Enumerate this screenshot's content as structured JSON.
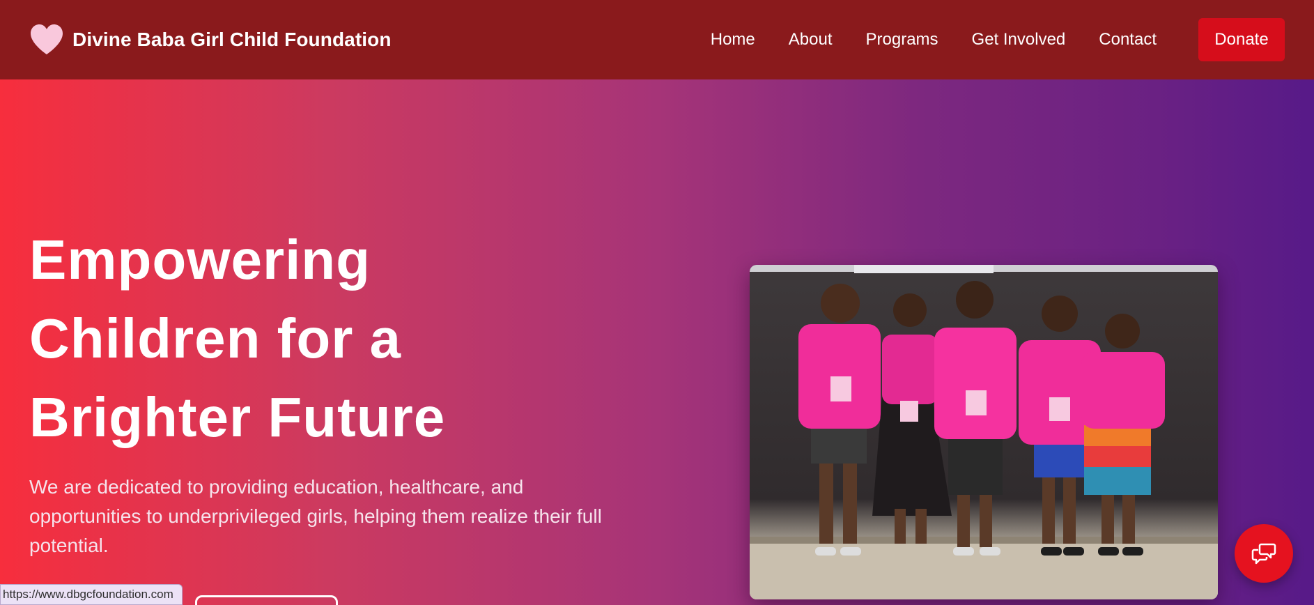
{
  "header": {
    "brand_name": "Divine Baba Girl Child Foundation",
    "logo_icon": "heart-icon",
    "nav": [
      {
        "label": "Home"
      },
      {
        "label": "About"
      },
      {
        "label": "Programs"
      },
      {
        "label": "Get Involved"
      },
      {
        "label": "Contact"
      }
    ],
    "donate_label": "Donate"
  },
  "hero": {
    "title_lines": [
      "Empowering",
      "Children for a",
      "Brighter Future"
    ],
    "description": "We are dedicated to providing education, healthcare, and opportunities to underprivileged girls, helping them realize their full potential.",
    "photo_subject": "five girls in pink foundation t-shirts"
  },
  "status_bar": {
    "url": "https://www.dbgcfoundation.com"
  },
  "chat": {
    "icon": "chat-bubbles-icon"
  },
  "colors": {
    "header_bg": "#8a1a1c",
    "donate_bg": "#d60d1b",
    "gradient_start": "#f72e3d",
    "gradient_end": "#571a88",
    "logo_heart": "#f9c8dc",
    "chat_fab": "#e5121f"
  }
}
